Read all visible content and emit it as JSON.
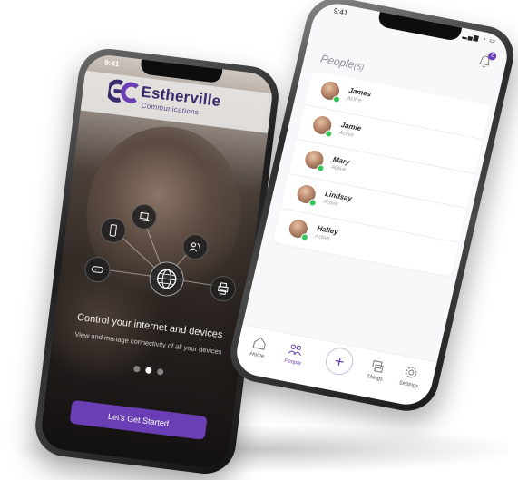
{
  "left_phone": {
    "status_time": "9:41",
    "brand": {
      "name": "Estherville",
      "subtitle": "Communications"
    },
    "device_icons": [
      "phone-icon",
      "laptop-icon",
      "people-wifi-icon",
      "gamepad-icon",
      "globe-icon",
      "printer-icon"
    ],
    "headline": "Control your internet and devices",
    "subtext": "View and manage connectivity of all your devices",
    "cta_label": "Let's Get Started",
    "carousel": {
      "count": 3,
      "active_index": 1
    }
  },
  "right_phone": {
    "status_time": "9:41",
    "notifications_badge": "2",
    "people_title": "People",
    "people_count": "(5)",
    "people": [
      {
        "name": "James",
        "status": "Active"
      },
      {
        "name": "Jamie",
        "status": "Active"
      },
      {
        "name": "Mary",
        "status": "Active"
      },
      {
        "name": "Lindsay",
        "status": "Active"
      },
      {
        "name": "Halley",
        "status": "Active"
      }
    ],
    "tabs": [
      {
        "label": "Home",
        "icon": "home-icon"
      },
      {
        "label": "People",
        "icon": "people-icon"
      },
      {
        "label": "",
        "icon": "plus-icon"
      },
      {
        "label": "Things",
        "icon": "things-icon"
      },
      {
        "label": "Settings",
        "icon": "gear-icon"
      }
    ]
  },
  "colors": {
    "accent": "#6a3fb5",
    "brand_dark": "#3a2a6e",
    "active_green": "#34c759"
  }
}
